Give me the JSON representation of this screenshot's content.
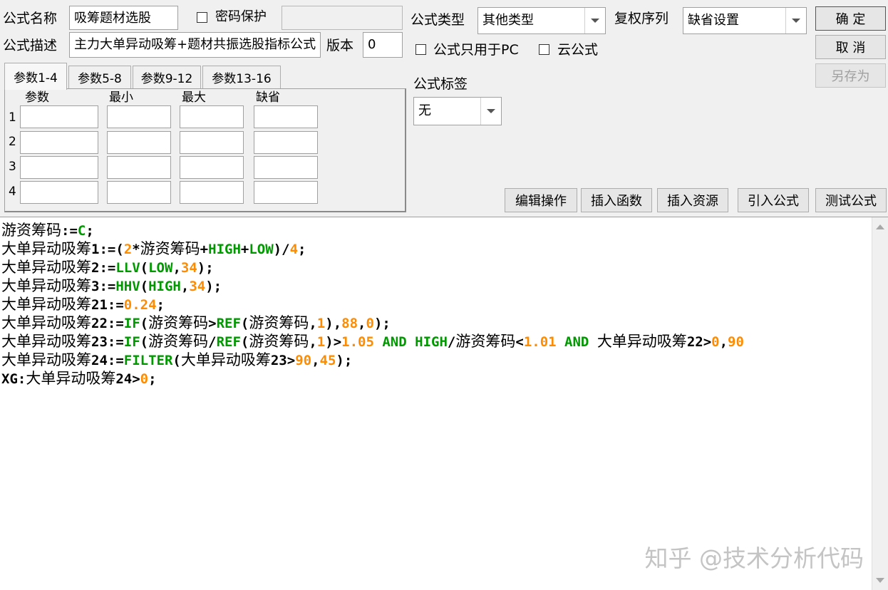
{
  "header": {
    "name_label": "公式名称",
    "name_value": "吸筹题材选股",
    "password_label": "密码保护",
    "password_value": "",
    "desc_label": "公式描述",
    "desc_value": "主力大单异动吸筹+题材共振选股指标公式",
    "version_label": "版本",
    "version_value": "0",
    "type_label": "公式类型",
    "type_value": "其他类型",
    "rights_label": "复权序列",
    "rights_value": "缺省设置",
    "pc_only_label": "公式只用于PC",
    "cloud_label": "云公式",
    "tag_label": "公式标签",
    "tag_value": "无"
  },
  "buttons": {
    "ok": "确  定",
    "cancel": "取  消",
    "save_as": "另存为",
    "edit_ops": "编辑操作",
    "insert_func": "插入函数",
    "insert_res": "插入资源",
    "import_formula": "引入公式",
    "test_formula": "测试公式"
  },
  "tabs": [
    {
      "label": "参数1-4"
    },
    {
      "label": "参数5-8"
    },
    {
      "label": "参数9-12"
    },
    {
      "label": "参数13-16"
    }
  ],
  "params": {
    "headers": [
      "参数",
      "最小",
      "最大",
      "缺省"
    ],
    "rows": [
      "1",
      "2",
      "3",
      "4"
    ]
  },
  "code_lines": [
    [
      [
        "游资筹码",
        "k"
      ],
      [
        ":=",
        "k"
      ],
      [
        "C",
        "g"
      ],
      [
        ";",
        "k"
      ]
    ],
    [
      [
        "大单异动吸筹",
        "k"
      ],
      [
        "1:=(",
        "k"
      ],
      [
        "2",
        "o"
      ],
      [
        "*",
        "k"
      ],
      [
        "游资筹码",
        "k"
      ],
      [
        "+",
        "k"
      ],
      [
        "HIGH",
        "g"
      ],
      [
        "+",
        "k"
      ],
      [
        "LOW",
        "g"
      ],
      [
        ")/",
        "k"
      ],
      [
        "4",
        "o"
      ],
      [
        ";",
        "k"
      ]
    ],
    [
      [
        "大单异动吸筹",
        "k"
      ],
      [
        "2:=",
        "k"
      ],
      [
        "LLV",
        "g"
      ],
      [
        "(",
        "k"
      ],
      [
        "LOW",
        "g"
      ],
      [
        ",",
        "k"
      ],
      [
        "34",
        "o"
      ],
      [
        ");",
        "k"
      ]
    ],
    [
      [
        "大单异动吸筹",
        "k"
      ],
      [
        "3:=",
        "k"
      ],
      [
        "HHV",
        "g"
      ],
      [
        "(",
        "k"
      ],
      [
        "HIGH",
        "g"
      ],
      [
        ",",
        "k"
      ],
      [
        "34",
        "o"
      ],
      [
        ");",
        "k"
      ]
    ],
    [
      [
        "大单异动吸筹",
        "k"
      ],
      [
        "21:=",
        "k"
      ],
      [
        "0.24",
        "o"
      ],
      [
        ";",
        "k"
      ]
    ],
    [
      [
        "大单异动吸筹",
        "k"
      ],
      [
        "22:=",
        "k"
      ],
      [
        "IF",
        "g"
      ],
      [
        "(",
        "k"
      ],
      [
        "游资筹码",
        "k"
      ],
      [
        ">",
        "k"
      ],
      [
        "REF",
        "g"
      ],
      [
        "(",
        "k"
      ],
      [
        "游资筹码",
        "k"
      ],
      [
        ",",
        "k"
      ],
      [
        "1",
        "o"
      ],
      [
        "),",
        "k"
      ],
      [
        "88",
        "o"
      ],
      [
        ",",
        "k"
      ],
      [
        "0",
        "o"
      ],
      [
        ");",
        "k"
      ]
    ],
    [
      [
        "大单异动吸筹",
        "k"
      ],
      [
        "23:=",
        "k"
      ],
      [
        "IF",
        "g"
      ],
      [
        "(",
        "k"
      ],
      [
        "游资筹码",
        "k"
      ],
      [
        "/",
        "k"
      ],
      [
        "REF",
        "g"
      ],
      [
        "(",
        "k"
      ],
      [
        "游资筹码",
        "k"
      ],
      [
        ",",
        "k"
      ],
      [
        "1",
        "o"
      ],
      [
        ")>",
        "k"
      ],
      [
        "1.05",
        "o"
      ],
      [
        " ",
        "k"
      ],
      [
        "AND",
        "g"
      ],
      [
        " ",
        "k"
      ],
      [
        "HIGH",
        "g"
      ],
      [
        "/",
        "k"
      ],
      [
        "游资筹码",
        "k"
      ],
      [
        "<",
        "k"
      ],
      [
        "1.01",
        "o"
      ],
      [
        " ",
        "k"
      ],
      [
        "AND",
        "g"
      ],
      [
        " ",
        "k"
      ],
      [
        "大单异动吸筹",
        "k"
      ],
      [
        "22>",
        "k"
      ],
      [
        "0",
        "o"
      ],
      [
        ",",
        "k"
      ],
      [
        "90",
        "o"
      ]
    ],
    [
      [
        "大单异动吸筹",
        "k"
      ],
      [
        "24:=",
        "k"
      ],
      [
        "FILTER",
        "g"
      ],
      [
        "(",
        "k"
      ],
      [
        "大单异动吸筹",
        "k"
      ],
      [
        "23>",
        "k"
      ],
      [
        "90",
        "o"
      ],
      [
        ",",
        "k"
      ],
      [
        "45",
        "o"
      ],
      [
        ");",
        "k"
      ]
    ],
    [
      [
        "XG:",
        "k"
      ],
      [
        "大单异动吸筹",
        "k"
      ],
      [
        "24>",
        "k"
      ],
      [
        "0",
        "o"
      ],
      [
        ";",
        "k"
      ]
    ]
  ],
  "watermark": "知乎 @技术分析代码",
  "colors": {
    "keyword": "#009900",
    "number": "#ff8c00",
    "text": "#000000"
  }
}
